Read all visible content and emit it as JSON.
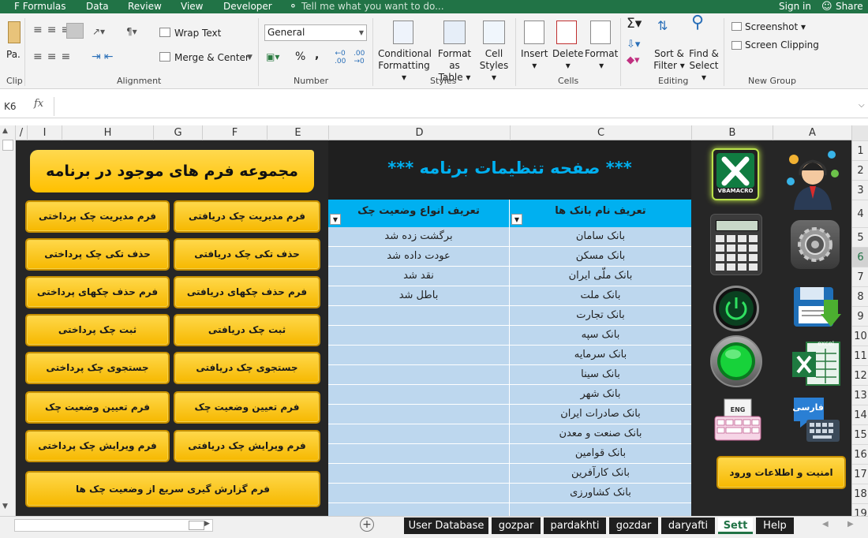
{
  "ribbon_tabs": [
    "F Formulas",
    "Data",
    "Review",
    "View",
    "Developer"
  ],
  "tell_me": "Tell me what you want to do...",
  "sign_in": "Sign in",
  "share": "Share",
  "ribbon": {
    "paste": "Pa.",
    "clip": "Clip",
    "wrap_text": "Wrap Text",
    "merge_center": "Merge & Center",
    "alignment": "Alignment",
    "number_format": "General",
    "number": "Number",
    "percent": "%",
    "comma": ",",
    "dec_inc": ".00 →.0",
    "dec_dec": ".00 .0",
    "cond_format_1": "Conditional",
    "cond_format_2": "Formatting",
    "format_as_1": "Format as",
    "format_as_2": "Table",
    "cell_styles_1": "Cell",
    "cell_styles_2": "Styles",
    "styles": "Styles",
    "insert": "Insert",
    "delete": "Delete",
    "format": "Format",
    "cells": "Cells",
    "sort_1": "Sort &",
    "sort_2": "Filter",
    "find_1": "Find &",
    "find_2": "Select",
    "editing": "Editing",
    "screenshot": "Screenshot",
    "screen_clipping": "Screen Clipping",
    "new_group": "New Group"
  },
  "name_box": "K6",
  "fx": "fx",
  "columns": [
    "I",
    "H",
    "G",
    "F",
    "E",
    "D",
    "C",
    "B",
    "A"
  ],
  "rows": [
    "1",
    "2",
    "3",
    "4",
    "5",
    "6",
    "7",
    "8",
    "9",
    "10",
    "11",
    "12",
    "13",
    "14",
    "15",
    "16",
    "17",
    "18",
    "19"
  ],
  "forms_title": "مجموعه فرم های موجود در برنامه",
  "settings_title": "*** صفحه تنظیمات برنامه ***",
  "buttons_right": [
    "فرم مدیریت چک دریافتی",
    "حذف تکی چک دریافتی",
    "فرم حذف چکهای دریافتی",
    "ثبت چک دریافتی",
    "جستجوی چک دریافتی",
    "فرم تعیین وضعیت چک دریافتی",
    "فرم ویرایش چک دریافتی"
  ],
  "buttons_left": [
    "فرم مدیریت چک پرداختی",
    "حذف تکی چک پرداختی",
    "فرم حذف چکهای پرداختی",
    "ثبت چک پرداختی",
    "جستجوی چک پرداختی",
    "فرم تعیین وضعیت چک پرداختی",
    "فرم ویرایش چک پرداختی"
  ],
  "report_button": "فرم گزارش گیری سریع از وضعیت چک ها",
  "security_button": "امنیت و اطلاعات ورود",
  "table": {
    "header_banks": "تعریف نام بانک ها",
    "header_status": "تعریف انواع وضعیت چک",
    "banks": [
      "بانک سامان",
      "بانک مسکن",
      "بانک ملّی ایران",
      "بانک ملت",
      "بانک تجارت",
      "بانک سپه",
      "بانک سرمایه",
      "بانک سینا",
      "بانک شهر",
      "بانک صادرات ایران",
      "بانک صنعت و معدن",
      "بانک قوامین",
      "بانک کارآفرین",
      "بانک کشاورزی"
    ],
    "statuses": [
      "برگشت زده شد",
      "عودت داده شد",
      "نقد شد",
      "باطل شد"
    ]
  },
  "logo_text": "VBAMACRO",
  "excel_text": "excel",
  "farsi_text": "فارسی",
  "keyboard_text": "ENG",
  "sheet_tabs": [
    "User Database",
    "gozpar",
    "pardakhti",
    "gozdar",
    "daryafti",
    "Sett",
    "Help"
  ],
  "active_sheet": "Sett",
  "colors": {
    "excel_green": "#217346",
    "gold": "#ffc000",
    "table_header": "#00b0f0",
    "table_body": "#bdd7ee",
    "title_blue": "#00b0f0"
  }
}
